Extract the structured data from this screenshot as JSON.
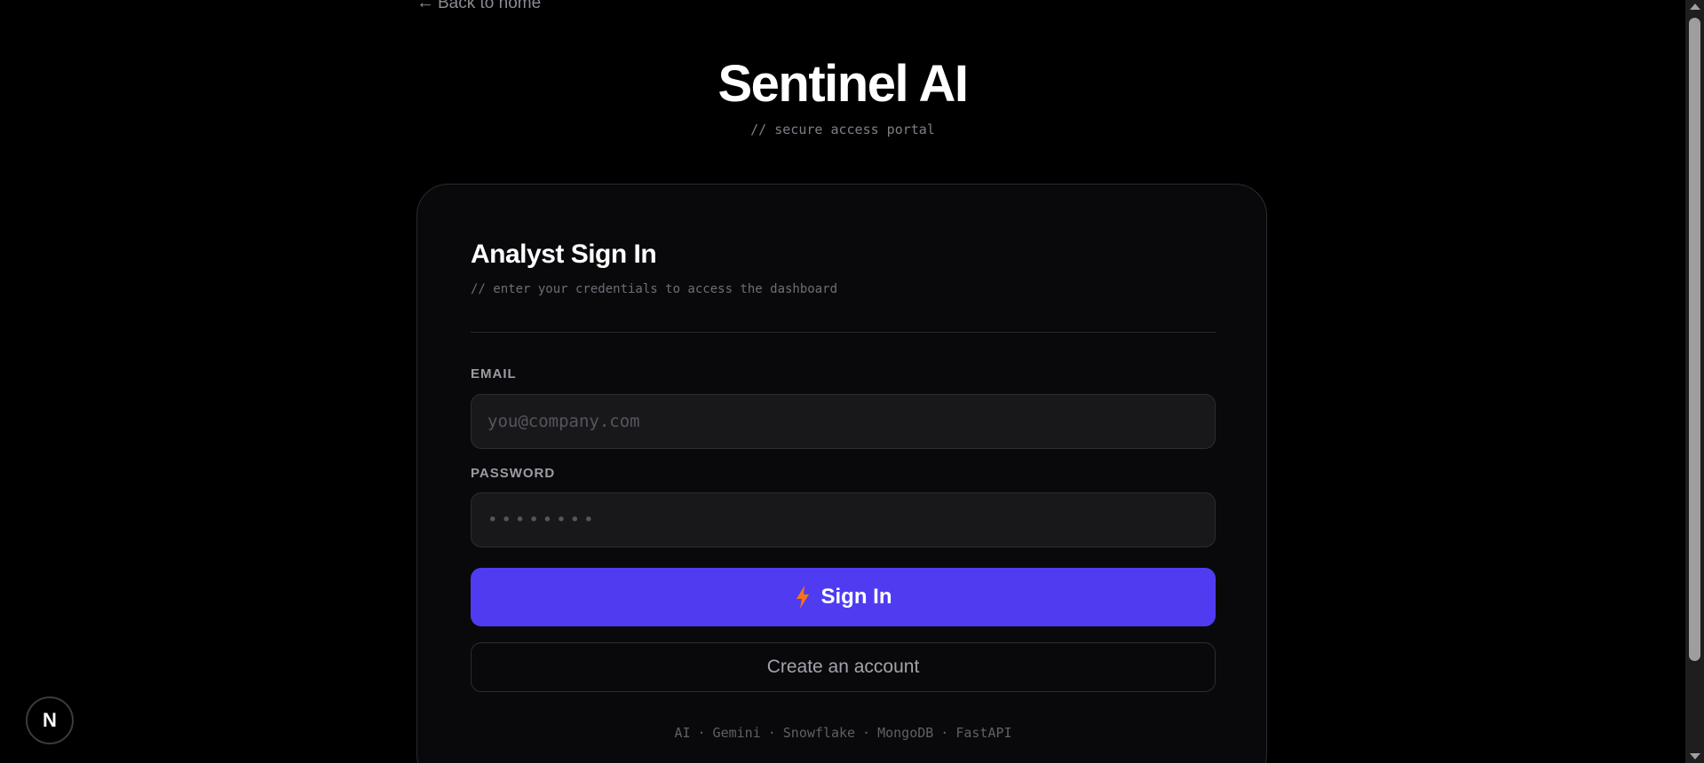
{
  "nav": {
    "back_arrow": "←",
    "back_label": "Back to home"
  },
  "brand": {
    "title": "Sentinel AI",
    "subtitle": "// secure access portal"
  },
  "card": {
    "title": "Analyst Sign In",
    "subtitle": "// enter your credentials to access the dashboard"
  },
  "form": {
    "email_label": "EMAIL",
    "email_placeholder": "you@company.com",
    "email_value": "",
    "password_label": "PASSWORD",
    "password_placeholder": "••••••••",
    "password_value": "",
    "signin_label": "Sign In",
    "signin_icon": "lightning-bolt-icon",
    "create_account_label": "Create an account"
  },
  "footer": {
    "tech": [
      "AI",
      "Gemini",
      "Snowflake",
      "MongoDB",
      "FastAPI"
    ],
    "separator": "·"
  },
  "badge": {
    "letter": "N"
  },
  "colors": {
    "background": "#000000",
    "card": "#09090b",
    "accent": "#4f3cf0",
    "bolt": "#f97316"
  }
}
